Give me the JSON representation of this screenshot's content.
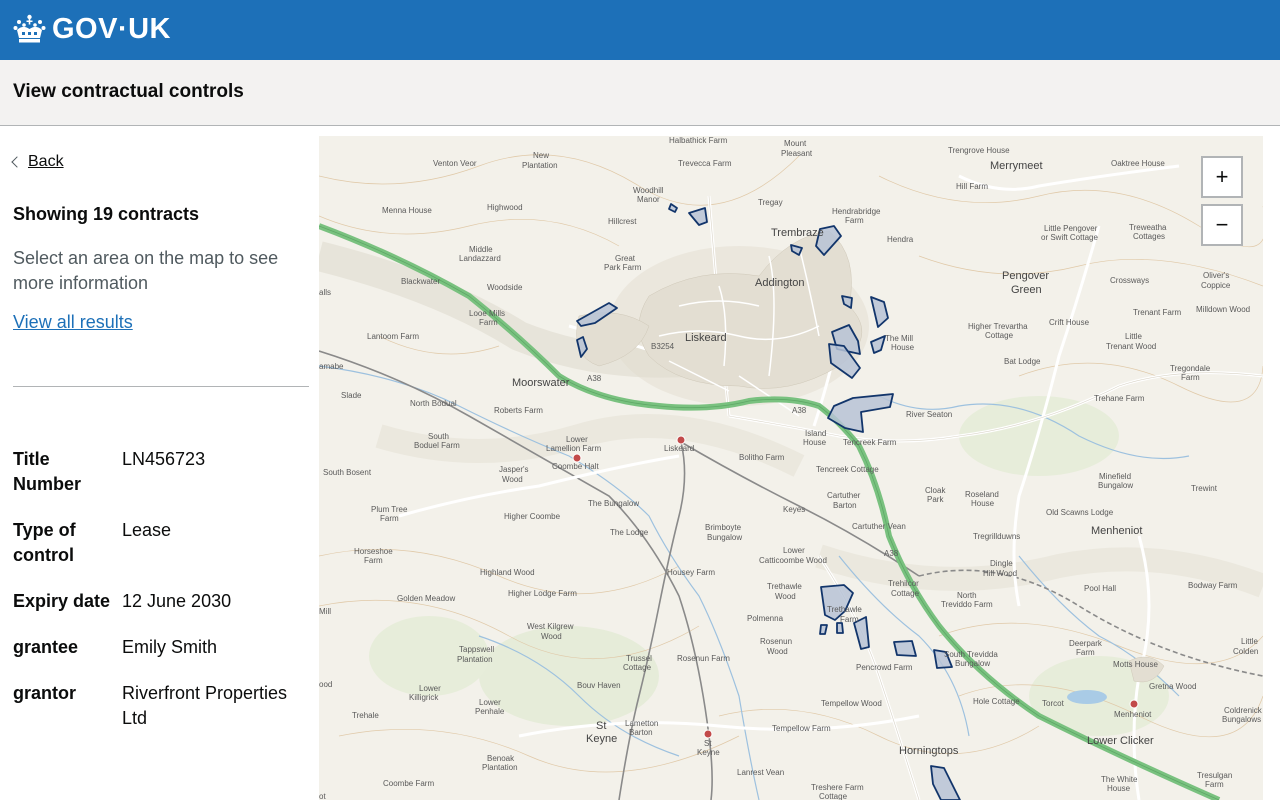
{
  "header": {
    "logo_text": "GOV·UK",
    "logo_icon": "crown-icon",
    "brand_color": "#1d70b8"
  },
  "service": {
    "name": "View contractual controls"
  },
  "sidebar": {
    "back_label": "Back",
    "showing": "Showing 19 contracts",
    "hint": "Select an area on the map to see more information",
    "view_all": "View all results",
    "details": [
      {
        "key": "Title Number",
        "value": "LN456723"
      },
      {
        "key": "Type of control",
        "value": "Lease"
      },
      {
        "key": "Expiry date",
        "value": "12 June 2030"
      },
      {
        "key": "grantee",
        "value": "Emily Smith"
      },
      {
        "key": "grantor",
        "value": "Riverfront Properties Ltd"
      }
    ]
  },
  "map": {
    "zoom_in": "+",
    "zoom_out": "−",
    "polygon_color": "#12356b",
    "towns": {
      "liskeard": "Liskeard",
      "trembraze": "Trembraze",
      "addington": "Addington",
      "moorswater": "Moorswater",
      "merrymeet": "Merrymeet",
      "pengover": "Pengover",
      "pengover2": "Green",
      "menheniot": "Menheniot",
      "horningtops": "Horningtops",
      "lower_clicker": "Lower Clicker",
      "st": "St",
      "keyne": "Keyne"
    },
    "labels": {
      "halbathick": "Halbathick Farm",
      "trevecca": "Trevecca Farm",
      "mount": "Mount",
      "pleasant": "Pleasant",
      "trengrove": "Trengrove House",
      "oaktree": "Oaktree House",
      "venton": "Venton Veor",
      "new_plantation1": "New",
      "new_plantation2": "Plantation",
      "woodhill1": "Woodhill",
      "woodhill2": "Manor",
      "tregay": "Tregay",
      "hendrabridge1": "Hendrabridge",
      "hendrabridge2": "Farm",
      "hill_farm": "Hill Farm",
      "menna": "Menna House",
      "highwood": "Highwood",
      "hillcrest": "Hillcrest",
      "hendra": "Hendra",
      "little_pengover1": "Little Pengover",
      "little_pengover2": "or Swift Cottage",
      "treweatha1": "Treweatha",
      "treweatha2": "Cottages",
      "middle1": "Middle",
      "middle2": "Landazzard",
      "great_park1": "Great",
      "great_park2": "Park Farm",
      "crossways": "Crossways",
      "olivers1": "Oliver's",
      "olivers2": "Coppice",
      "blackwater": "Blackwater",
      "woodside": "Woodside",
      "tenant": "Trenant Farm",
      "milldown": "Milldown Wood",
      "looe1": "Looe Mills",
      "looe2": "Farm",
      "higher_trevartha1": "Higher Trevartha",
      "higher_trevartha2": "Cottage",
      "crift": "Crift House",
      "lantoom": "Lantoom Farm",
      "the_mill1": "The Mill",
      "the_mill2": "House",
      "little_trenant1": "Little",
      "little_trenant2": "Trenant Wood",
      "bat_lodge": "Bat Lodge",
      "tregondale1": "Tregondale",
      "tregondale2": "Farm",
      "slade": "Slade",
      "north_bodual": "North Bodual",
      "trehane": "Trehane Farm",
      "river_seaton": "River Seaton",
      "roberts": "Roberts Farm",
      "south_bodual1": "South",
      "south_bodual2": "Boduel Farm",
      "lower_lamellion1": "Lower",
      "lower_lamellion2": "Lamellion Farm",
      "island1": "Island",
      "island2": "House",
      "tencreek_farm": "Tencreek Farm",
      "coombe_halt": "Coombe Halt",
      "liskeard_station": "Liskeard",
      "bolitho": "Bolitho Farm",
      "south_bosent": "South Bosent",
      "jaspers1": "Jasper's",
      "jaspers2": "Wood",
      "tencreek_cottage": "Tencreek Cottage",
      "minefield1": "Minefield",
      "minefield2": "Bungalow",
      "trewint": "Trewint",
      "cloak1": "Cloak",
      "cloak2": "Park",
      "roseland1": "Roseland",
      "roseland2": "House",
      "cartuther1": "Cartuther",
      "cartuther2": "Barton",
      "plum_tree1": "Plum Tree",
      "plum_tree2": "Farm",
      "bungalow": "The Bungalow",
      "keyes": "Keyes",
      "old_scawns": "Old Scawns Lodge",
      "higher_coombe": "Higher Coombe",
      "cartuther_vean": "Cartuther Vean",
      "horseshoe1": "Horseshoe",
      "horseshoe2": "Farm",
      "the_lodge": "The Lodge",
      "brimboyte1": "Brimboyte",
      "brimboyte2": "Bungalow",
      "tregrillduwns": "Tregrillduwns",
      "lower_catt1": "Lower",
      "lower_catt2": "Catticoombe Wood",
      "dingle1": "Dingle",
      "dingle2": "Hill Wood",
      "highland": "Highland Wood",
      "housey": "Housey Farm",
      "trethawle_wood1": "Trethawle",
      "trethawle_wood2": "Wood",
      "trehilcor1": "Trehilcor",
      "trehilcor2": "Cottage",
      "pool_hall": "Pool Hall",
      "bodway": "Bodway Farm",
      "golden": "Golden Meadow",
      "higher_lodge": "Higher Lodge Farm",
      "north_trevidd1": "North",
      "north_trevidd2": "Treviddo Farm",
      "mill": "Mill",
      "trethawle_farm1": "Trethawle",
      "trethawle_farm2": "Farm",
      "west_kilgrew1": "West Kilgrew",
      "west_kilgrew2": "Wood",
      "polmenna": "Polmenna",
      "rosenun_wood1": "Rosenun",
      "rosenun_wood2": "Wood",
      "tappswell1": "Tappswell",
      "tappswell2": "Plantation",
      "trussel1": "Trussel",
      "trussel2": "Cottage",
      "rosenun_farm": "Rosenun Farm",
      "pencrowd": "Pencrowd Farm",
      "south_trevidd1": "South Trevidda",
      "south_trevidd2": "Bungalow",
      "deerpark1": "Deerpark",
      "deerpark2": "Farm",
      "little_colden1": "Little",
      "little_colden2": "Colden",
      "motts": "Motts House",
      "gretna": "Gretna Wood",
      "bouv": "Bouv Haven",
      "lower_killigrick1": "Lower",
      "lower_killigrick2": "Killigrick",
      "tempellow_wood": "Tempellow Wood",
      "hole_cottage": "Hole Cottage",
      "torcot": "Torcot",
      "coldrenick1": "Coldrenick",
      "coldrenick2": "Bungalows",
      "trehale": "Trehale",
      "lower_penhale1": "Lower",
      "lower_penhale2": "Penhale",
      "lametton1": "Lametton",
      "lametton2": "Barton",
      "tempellow_farm": "Tempellow Farm",
      "benoak1": "Benoak",
      "benoak2": "Plantation",
      "st_keyne_station1": "St",
      "st_keyne_station2": "Keyne",
      "menheniot_station": "Menheniot",
      "lanrest": "Lanrest Vean",
      "white_house1": "The White",
      "white_house2": "House",
      "tresulgan1": "Tresulgan",
      "tresulgan2": "Farm",
      "coombe_farm": "Coombe Farm",
      "treshere1": "Treshere Farm",
      "treshere2": "Cottage",
      "ood": "ood",
      "alls": "alls",
      "amabe": "amabe",
      "ot": "ot",
      "road_b3254": "B3254",
      "a38a": "A38",
      "a38b": "A38",
      "a38c": "A38"
    }
  }
}
